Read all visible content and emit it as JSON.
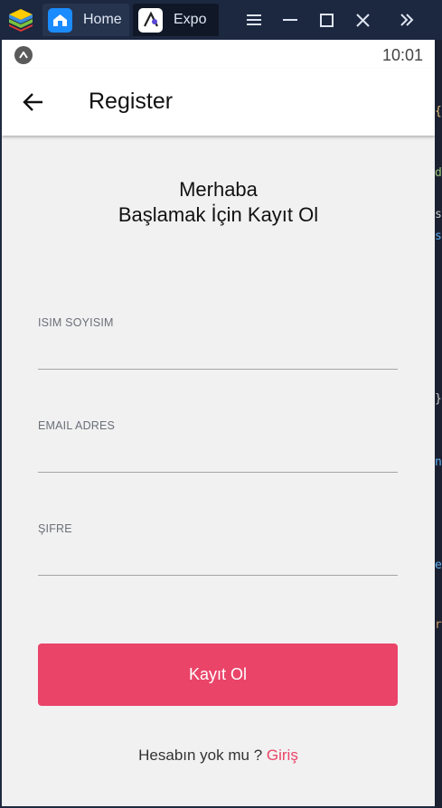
{
  "emulator": {
    "tabs": [
      {
        "label": "Home",
        "icon": "home-icon"
      },
      {
        "label": "Expo",
        "icon": "expo-icon"
      }
    ],
    "controls": [
      "menu-icon",
      "minimize-icon",
      "maximize-icon",
      "close-icon",
      "double-chevron-icon"
    ]
  },
  "status_bar": {
    "time": "10:01",
    "icon": "expo-status-icon"
  },
  "app_bar": {
    "title": "Register",
    "back_icon": "arrow-left-icon"
  },
  "greeting": {
    "line1": "Merhaba",
    "line2": "Başlamak İçin Kayıt Ol"
  },
  "form": {
    "fields": [
      {
        "label": "ISIM SOYISIM",
        "value": ""
      },
      {
        "label": "EMAIL ADRES",
        "value": ""
      },
      {
        "label": "ŞIFRE",
        "value": ""
      }
    ],
    "submit_label": "Kayıt Ol"
  },
  "footer": {
    "prompt": "Hesabın yok mu ?",
    "link": "Giriş"
  },
  "colors": {
    "accent": "#ea4469",
    "titlebar": "#1c2740",
    "screen_bg": "#f1f1f1"
  }
}
